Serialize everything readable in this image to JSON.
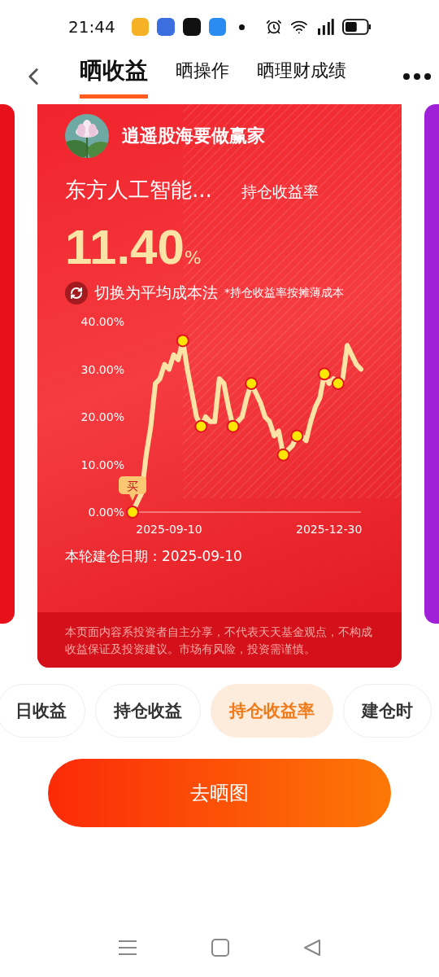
{
  "status_bar": {
    "time": "21:44"
  },
  "header": {
    "tabs": [
      {
        "label": "晒收益",
        "selected": true
      },
      {
        "label": "晒操作",
        "selected": false
      },
      {
        "label": "晒理财成绩",
        "selected": false
      }
    ]
  },
  "card": {
    "user_name": "逍遥股海要做赢家",
    "fund_name": "东方人工智能...",
    "metric_label": "持仓收益率",
    "value": "11.40",
    "unit": "%",
    "switch_label": "切换为平均成本法",
    "note": "*持仓收益率按摊薄成本",
    "chart_data": {
      "type": "line",
      "ylim": [
        0,
        40
      ],
      "yticks": [
        {
          "value": 0,
          "label": "0.00%"
        },
        {
          "value": 10,
          "label": "10.00%"
        },
        {
          "value": 20,
          "label": "20.00%"
        },
        {
          "value": 30,
          "label": "30.00%"
        },
        {
          "value": 40,
          "label": "40.00%"
        }
      ],
      "categories": [
        null,
        null,
        null,
        null,
        null,
        null,
        null,
        null,
        "2025-09-10",
        null,
        null,
        null,
        null,
        null,
        null,
        null,
        null,
        null,
        null,
        null,
        null,
        null,
        null,
        null,
        null,
        null,
        null,
        null,
        null,
        null,
        null,
        null,
        null,
        null,
        null,
        null,
        null,
        null,
        null,
        null,
        null,
        null,
        null,
        "2025-12-30",
        null,
        null,
        null,
        null,
        null,
        null,
        null
      ],
      "series": [
        {
          "color": "#fbe3a6",
          "values": [
            0,
            2,
            4,
            12,
            18,
            27,
            28,
            31,
            30,
            33,
            32,
            36,
            30,
            25,
            20,
            18,
            20,
            19,
            19,
            28,
            27,
            22,
            18,
            19,
            20,
            24,
            27,
            25,
            23,
            20,
            19,
            16,
            17,
            12,
            13,
            14,
            16,
            16,
            15,
            19,
            22,
            24,
            29,
            27,
            28,
            27,
            28,
            35,
            33,
            31,
            30
          ]
        }
      ],
      "annotations": [
        "买"
      ]
    },
    "start_date_label": "本轮建仓日期：2025-09-10",
    "disclaimer": "本页面内容系投资者自主分享，不代表天天基金观点，不构成收益保证及投资建议。市场有风险，投资需谨慎。"
  },
  "chips": [
    {
      "label": "日收益",
      "selected": false
    },
    {
      "label": "持仓收益",
      "selected": false
    },
    {
      "label": "持仓收益率",
      "selected": true
    },
    {
      "label": "建仓时",
      "selected": false
    }
  ],
  "action_button": "去晒图"
}
